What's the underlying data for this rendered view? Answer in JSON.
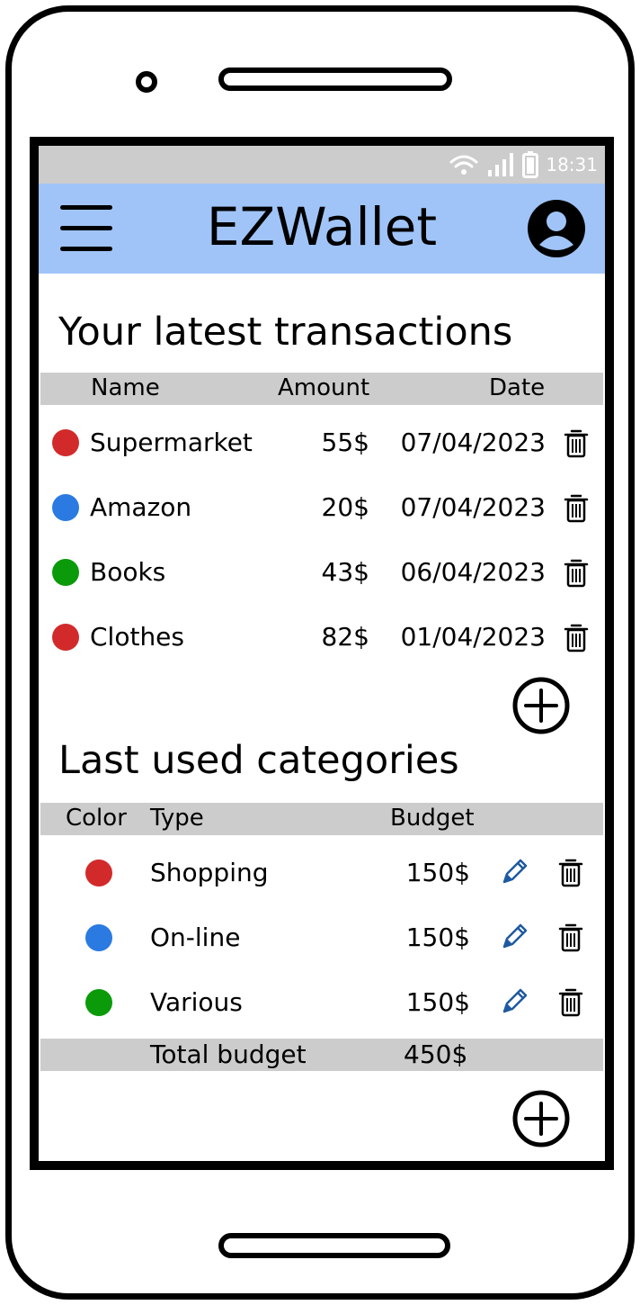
{
  "status_bar": {
    "time": "18:31",
    "icons": [
      "wifi-icon",
      "signal-icon",
      "battery-icon"
    ]
  },
  "app_bar": {
    "title": "EZWallet",
    "menu_icon": "hamburger-menu-icon",
    "account_icon": "account-circle-icon"
  },
  "transactions": {
    "title": "Your latest transactions",
    "headers": {
      "name": "Name",
      "amount": "Amount",
      "date": "Date"
    },
    "rows": [
      {
        "color": "#d22a2a",
        "name": "Supermarket",
        "amount": "55$",
        "date": "07/04/2023"
      },
      {
        "color": "#2a7ae2",
        "name": "Amazon",
        "amount": "20$",
        "date": "07/04/2023"
      },
      {
        "color": "#0a9a0a",
        "name": "Books",
        "amount": "43$",
        "date": "06/04/2023"
      },
      {
        "color": "#d22a2a",
        "name": "Clothes",
        "amount": "82$",
        "date": "01/04/2023"
      }
    ]
  },
  "categories": {
    "title": "Last used categories",
    "headers": {
      "color": "Color",
      "type": "Type",
      "budget": "Budget"
    },
    "rows": [
      {
        "color": "#d22a2a",
        "type": "Shopping",
        "budget": "150$"
      },
      {
        "color": "#2a7ae2",
        "type": "On-line",
        "budget": "150$"
      },
      {
        "color": "#0a9a0a",
        "type": "Various",
        "budget": "150$"
      }
    ],
    "total": {
      "label": "Total budget",
      "value": "450$"
    }
  },
  "colors": {
    "app_bar": "#a0c4f8",
    "status_bar": "#cccccc",
    "table_header": "#cccccc",
    "edit_icon": "#1e5aa0"
  }
}
